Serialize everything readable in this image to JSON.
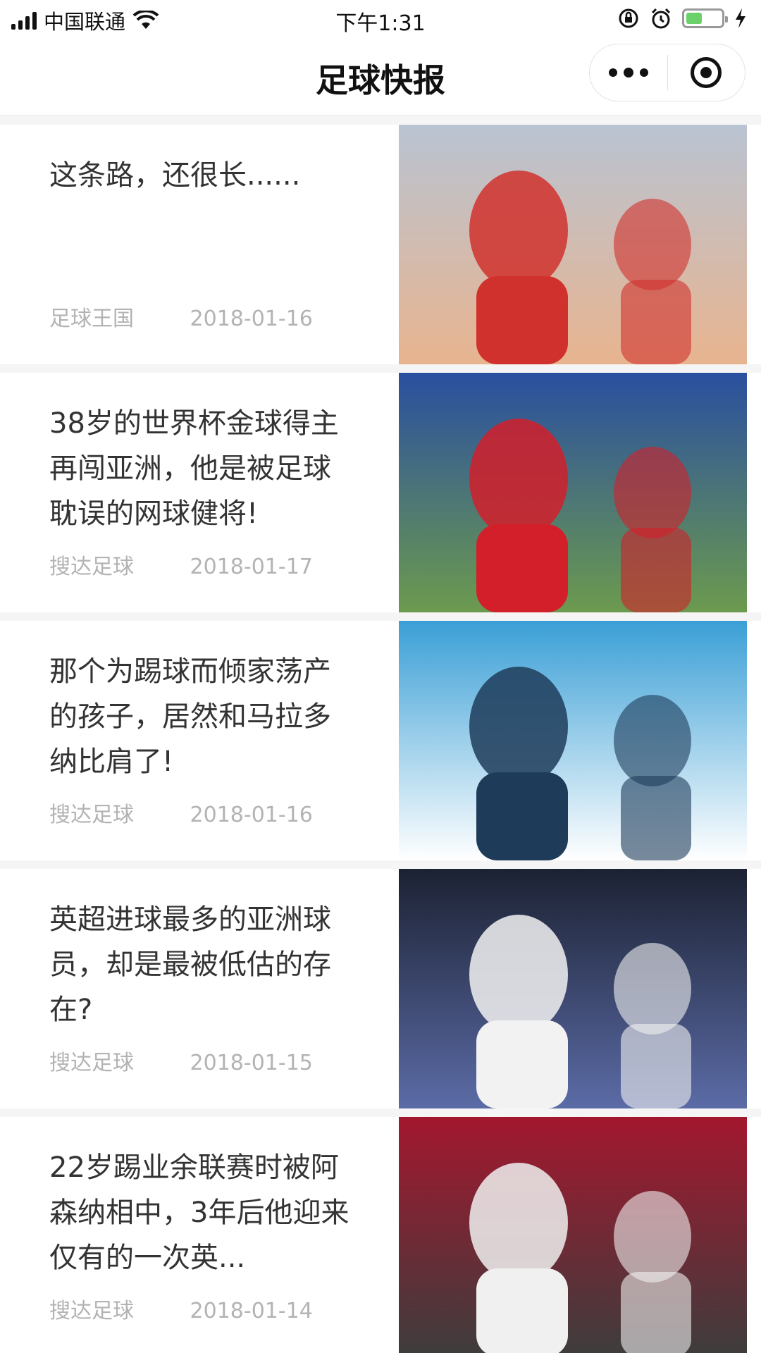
{
  "status_bar": {
    "carrier": "中国联通",
    "time": "下午1:31",
    "battery_level": 0.45
  },
  "nav": {
    "title": "足球快报"
  },
  "articles": [
    {
      "title": "这条路，还很长......",
      "source": "足球王国",
      "date": "2018-01-16",
      "thumb_desc": "player-portrait-red-jersey",
      "thumb_colors": [
        "#b9c3d2",
        "#d0312d",
        "#e8b48f"
      ]
    },
    {
      "title": "38岁的世界杯金球得主再闯亚洲，他是被足球耽误的网球健将!",
      "source": "搜达足球",
      "date": "2018-01-17",
      "thumb_desc": "player-blue-kit-stadium",
      "thumb_colors": [
        "#2a4fa0",
        "#d21f2a",
        "#6c9a4e"
      ]
    },
    {
      "title": "那个为踢球而倾家荡产的孩子，居然和马拉多纳比肩了!",
      "source": "搜达足球",
      "date": "2018-01-16",
      "thumb_desc": "napoli-players-celebrating",
      "thumb_colors": [
        "#3a9fd6",
        "#1e3c5a",
        "#ffffff"
      ]
    },
    {
      "title": "英超进球最多的亚洲球员，却是最被低估的存在?",
      "source": "搜达足球",
      "date": "2018-01-15",
      "thumb_desc": "player-white-kit-night",
      "thumb_colors": [
        "#1c2233",
        "#f2f2f2",
        "#5b6ba6"
      ]
    },
    {
      "title": "22岁踢业余联赛时被阿森纳相中，3年后他迎来仅有的一次英...",
      "source": "搜达足球",
      "date": "2018-01-14",
      "thumb_desc": "players-red-kit-huddle",
      "thumb_colors": [
        "#a3172e",
        "#f0f0f0",
        "#3d3d3d"
      ]
    }
  ]
}
